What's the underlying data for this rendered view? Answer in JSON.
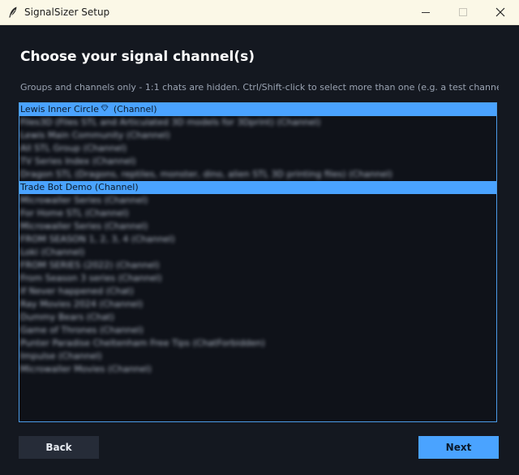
{
  "window": {
    "title": "SignalSizer Setup"
  },
  "header": {
    "heading": "Choose your signal channel(s)",
    "info": "Groups and channels only - 1:1 chats are hidden. Ctrl/Shift-click to select more than one (e.g. a test channel alor"
  },
  "channels": [
    {
      "label": "Lewis Inner Circle",
      "suffix": "(Channel)",
      "selected": true,
      "blurred": false,
      "icon": "diamond-icon"
    },
    {
      "label": "Files3D (Files STL and Articulated 3D models for 3Dprint) (Channel)",
      "selected": false,
      "blurred": true
    },
    {
      "label": "Lewis Main Community (Channel)",
      "selected": false,
      "blurred": true
    },
    {
      "label": "All STL Group (Channel)",
      "selected": false,
      "blurred": true
    },
    {
      "label": "TV Series Index (Channel)",
      "selected": false,
      "blurred": true
    },
    {
      "label": "Dragon STL (Dragons, reptiles, monster, dino, alien STL 3D printing files) (Channel)",
      "selected": false,
      "blurred": true
    },
    {
      "label": "Trade Bot Demo  (Channel)",
      "selected": true,
      "blurred": false
    },
    {
      "label": "Microwaller Series (Channel)",
      "selected": false,
      "blurred": true
    },
    {
      "label": "For Home STL (Channel)",
      "selected": false,
      "blurred": true
    },
    {
      "label": "Microwaller Series (Channel)",
      "selected": false,
      "blurred": true
    },
    {
      "label": "FROM SEASON 1, 2, 3, 4 (Channel)",
      "selected": false,
      "blurred": true
    },
    {
      "label": "Loki (Channel)",
      "selected": false,
      "blurred": true
    },
    {
      "label": "FROM SERIES (2022) (Channel)",
      "selected": false,
      "blurred": true
    },
    {
      "label": "From Season 3 series (Channel)",
      "selected": false,
      "blurred": true
    },
    {
      "label": "If Never happened (Chat)",
      "selected": false,
      "blurred": true
    },
    {
      "label": "Ray Movies 2024 (Channel)",
      "selected": false,
      "blurred": true
    },
    {
      "label": "Dummy Bears (Chat)",
      "selected": false,
      "blurred": true
    },
    {
      "label": "Game of Thrones (Channel)",
      "selected": false,
      "blurred": true
    },
    {
      "label": "Punter Paradise Cheltenham Free Tips (ChatForbidden)",
      "selected": false,
      "blurred": true
    },
    {
      "label": "Impulse (Channel)",
      "selected": false,
      "blurred": true
    },
    {
      "label": "Microwaller Movies (Channel)",
      "selected": false,
      "blurred": true
    }
  ],
  "buttons": {
    "back_label": "Back",
    "next_label": "Next"
  },
  "colors": {
    "accent": "#4aa3ff",
    "background": "#141820",
    "titlebar": "#fbf8e7"
  }
}
